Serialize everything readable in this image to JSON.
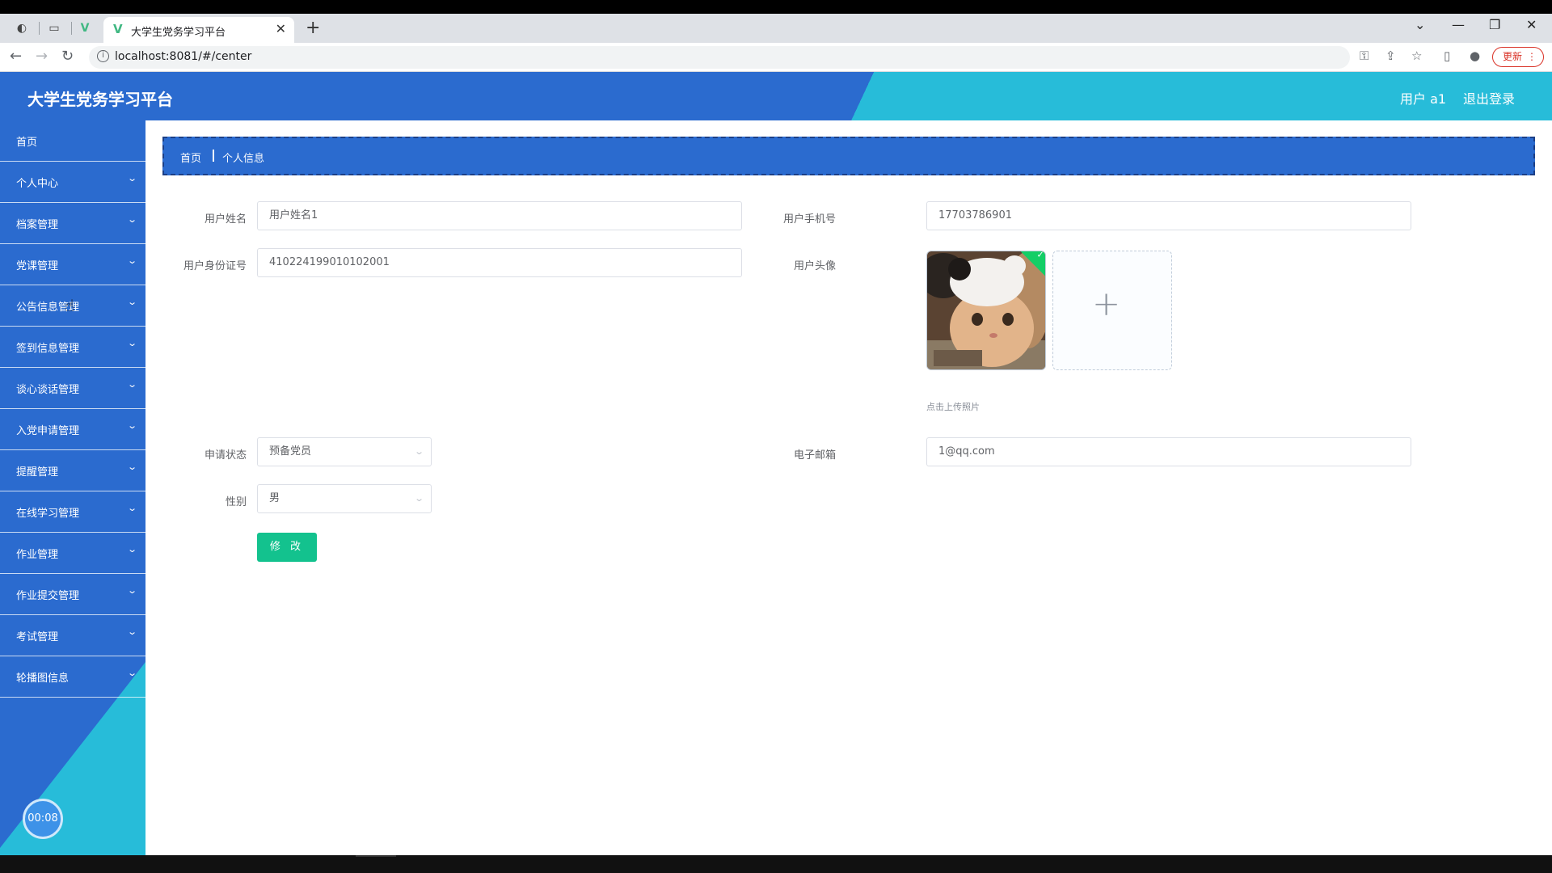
{
  "browser": {
    "tab_title": "大学生党务学习平台",
    "tab_close": "✕",
    "new_tab": "+",
    "url": "localhost:8081/#/center",
    "update_label": "更新",
    "update_menu": "⋮",
    "window": {
      "dropdown": "⌄",
      "minimize": "—",
      "restore": "❐",
      "close": "✕"
    }
  },
  "header": {
    "title": "大学生党务学习平台",
    "user_label": "用户 a1",
    "logout_label": "退出登录"
  },
  "sidebar": {
    "items": [
      {
        "label": "首页",
        "has_children": false
      },
      {
        "label": "个人中心",
        "has_children": true
      },
      {
        "label": "档案管理",
        "has_children": true
      },
      {
        "label": "党课管理",
        "has_children": true
      },
      {
        "label": "公告信息管理",
        "has_children": true
      },
      {
        "label": "签到信息管理",
        "has_children": true
      },
      {
        "label": "谈心谈话管理",
        "has_children": true
      },
      {
        "label": "入党申请管理",
        "has_children": true
      },
      {
        "label": "提醒管理",
        "has_children": true
      },
      {
        "label": "在线学习管理",
        "has_children": true
      },
      {
        "label": "作业管理",
        "has_children": true
      },
      {
        "label": "作业提交管理",
        "has_children": true
      },
      {
        "label": "考试管理",
        "has_children": true
      },
      {
        "label": "轮播图信息",
        "has_children": true
      }
    ],
    "timer": "00:08"
  },
  "breadcrumb": {
    "home": "首页",
    "current": "个人信息"
  },
  "form": {
    "username": {
      "label": "用户姓名",
      "value": "用户姓名1"
    },
    "idcard": {
      "label": "用户身份证号",
      "value": "410224199010102001"
    },
    "phone": {
      "label": "用户手机号",
      "value": "17703786901"
    },
    "avatar": {
      "label": "用户头像",
      "tip": "点击上传照片",
      "plus": "+",
      "check": "✓"
    },
    "status": {
      "label": "申请状态",
      "value": "预备党员"
    },
    "gender": {
      "label": "性别",
      "value": "男"
    },
    "email": {
      "label": "电子邮箱",
      "value": "1@qq.com"
    },
    "submit_label": "修 改"
  },
  "icons": {
    "back": "←",
    "forward": "→",
    "reload": "↻",
    "key": "⚿",
    "share": "⇪",
    "star": "☆",
    "sidepanel": "▯",
    "profile": "●",
    "chevron": "⌄"
  }
}
